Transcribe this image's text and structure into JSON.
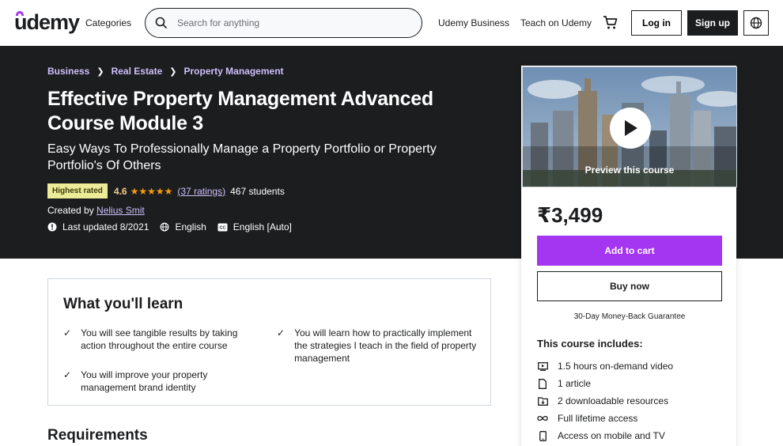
{
  "header": {
    "logo": "udemy",
    "categories": "Categories",
    "search_placeholder": "Search for anything",
    "business": "Udemy Business",
    "teach": "Teach on Udemy",
    "login": "Log in",
    "signup": "Sign up"
  },
  "breadcrumb": [
    "Business",
    "Real Estate",
    "Property Management"
  ],
  "course": {
    "title": "Effective Property Management Advanced Course Module 3",
    "subtitle": "Easy Ways To Professionally Manage a Property Portfolio or Property Portfolio's Of Others",
    "badge": "Highest rated",
    "rating": "4.6",
    "stars": "★★★★★",
    "ratings_count": "(37 ratings)",
    "students": "467 students",
    "created_by_label": "Created by",
    "author": "Nelius Smit",
    "last_updated": "Last updated 8/2021",
    "language": "English",
    "captions": "English [Auto]"
  },
  "card": {
    "preview_label": "Preview this course",
    "price": "₹3,499",
    "add_to_cart": "Add to cart",
    "buy_now": "Buy now",
    "guarantee": "30-Day Money-Back Guarantee",
    "includes_title": "This course includes:",
    "includes": [
      {
        "icon": "video-icon",
        "text": "1.5 hours on-demand video"
      },
      {
        "icon": "file-icon",
        "text": "1 article"
      },
      {
        "icon": "folder-icon",
        "text": "2 downloadable resources"
      },
      {
        "icon": "infinity-icon",
        "text": "Full lifetime access"
      },
      {
        "icon": "mobile-icon",
        "text": "Access on mobile and TV"
      }
    ]
  },
  "learn": {
    "heading": "What you'll learn",
    "items": [
      "You will see tangible results by taking action throughout the entire course",
      "You will learn how to practically implement the strategies I teach in the field of property management",
      "You will improve your property management brand identity"
    ]
  },
  "requirements_heading": "Requirements",
  "colors": {
    "accent": "#a435f0",
    "hero_bg": "#1c1d1f",
    "link": "#cec0fc",
    "badge_bg": "#eceb98",
    "star": "#f69c08"
  }
}
